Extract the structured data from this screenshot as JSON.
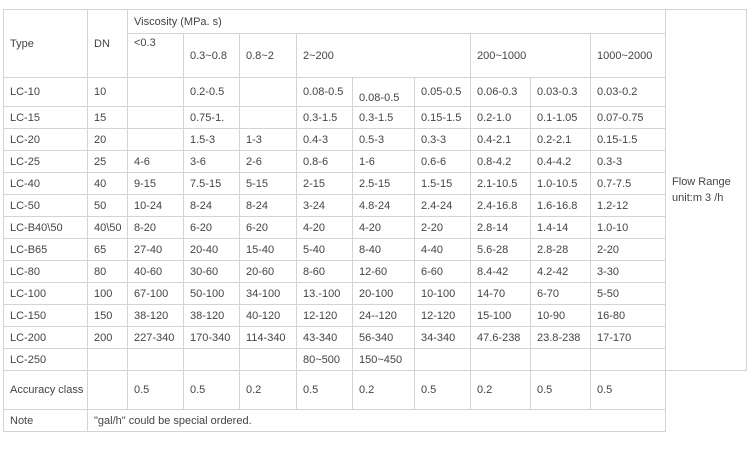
{
  "header": {
    "type": "Type",
    "dn": "DN",
    "viscosity": "Viscosity (MPa. s)",
    "ranges": [
      "<0.3",
      "0.3~0.8",
      "0.8~2",
      "2~200",
      "200~1000",
      "1000~2000"
    ]
  },
  "rows": [
    {
      "type": "LC-10",
      "dn": "10",
      "v": [
        "",
        "0.2-0.5",
        "",
        "0.08-0.5",
        "0.08-0.5",
        "0.05-0.5",
        "0.06-0.3",
        "0.03-0.3",
        "0.03-0.2"
      ]
    },
    {
      "type": "LC-15",
      "dn": "15",
      "v": [
        "",
        "0.75-1.",
        "",
        "0.3-1.5",
        "0.3-1.5",
        "0.15-1.5",
        "0.2-1.0",
        "0.1-1.05",
        "0.07-0.75"
      ]
    },
    {
      "type": "LC-20",
      "dn": "20",
      "v": [
        "",
        "1.5-3",
        "1-3",
        "0.4-3",
        "0.5-3",
        "0.3-3",
        "0.4-2.1",
        "0.2-2.1",
        "0.15-1.5"
      ]
    },
    {
      "type": "LC-25",
      "dn": "25",
      "v": [
        "4-6",
        "3-6",
        "2-6",
        "0.8-6",
        "1-6",
        "0.6-6",
        "0.8-4.2",
        "0.4-4.2",
        "0.3-3"
      ]
    },
    {
      "type": "LC-40",
      "dn": "40",
      "v": [
        "9-15",
        "7.5-15",
        "5-15",
        "2-15",
        "2.5-15",
        "1.5-15",
        "2.1-10.5",
        "1.0-10.5",
        "0.7-7.5"
      ]
    },
    {
      "type": "LC-50",
      "dn": "50",
      "v": [
        "10-24",
        "8-24",
        "8-24",
        "3-24",
        "4.8-24",
        "2.4-24",
        "2.4-16.8",
        "1.6-16.8",
        "1.2-12"
      ]
    },
    {
      "type": "LC-B40\\50",
      "dn": "40\\50",
      "v": [
        "8-20",
        "6-20",
        "6-20",
        "4-20",
        "4-20",
        "2-20",
        "2.8-14",
        "1.4-14",
        "1.0-10"
      ]
    },
    {
      "type": "LC-B65",
      "dn": "65",
      "v": [
        "27-40",
        "20-40",
        "15-40",
        "5-40",
        "8-40",
        "4-40",
        "5.6-28",
        "2.8-28",
        "2-20"
      ]
    },
    {
      "type": "LC-80",
      "dn": "80",
      "v": [
        "40-60",
        "30-60",
        "20-60",
        "8-60",
        "12-60",
        "6-60",
        "8.4-42",
        "4.2-42",
        "3-30"
      ]
    },
    {
      "type": "LC-100",
      "dn": "100",
      "v": [
        "67-100",
        "50-100",
        "34-100",
        "13.-100",
        "20-100",
        "10-100",
        "14-70",
        "6-70",
        "5-50"
      ]
    },
    {
      "type": "LC-150",
      "dn": "150",
      "v": [
        "38-120",
        "38-120",
        "40-120",
        "12-120",
        "24--120",
        "12-120",
        "15-100",
        "10-90",
        "16-80"
      ]
    },
    {
      "type": "LC-200",
      "dn": "200",
      "v": [
        "227-340",
        "170-340",
        "114-340",
        "43-340",
        "56-340",
        "34-340",
        "47.6-238",
        "23.8-238",
        "17-170"
      ]
    },
    {
      "type": "LC-250",
      "dn": "",
      "v": [
        "",
        "",
        "",
        "80~500",
        "150~450",
        "",
        "",
        "",
        ""
      ]
    }
  ],
  "accuracy": {
    "label": "Accuracy class",
    "v": [
      "0.5",
      "0.5",
      "0.2",
      "0.5",
      "0.2",
      "0.5",
      "0.2",
      "0.5",
      "0.5"
    ]
  },
  "note": {
    "label": "Note",
    "text": "\"gal/h\" could be special ordered."
  },
  "side_note": "Flow Range unit:m 3 /h"
}
